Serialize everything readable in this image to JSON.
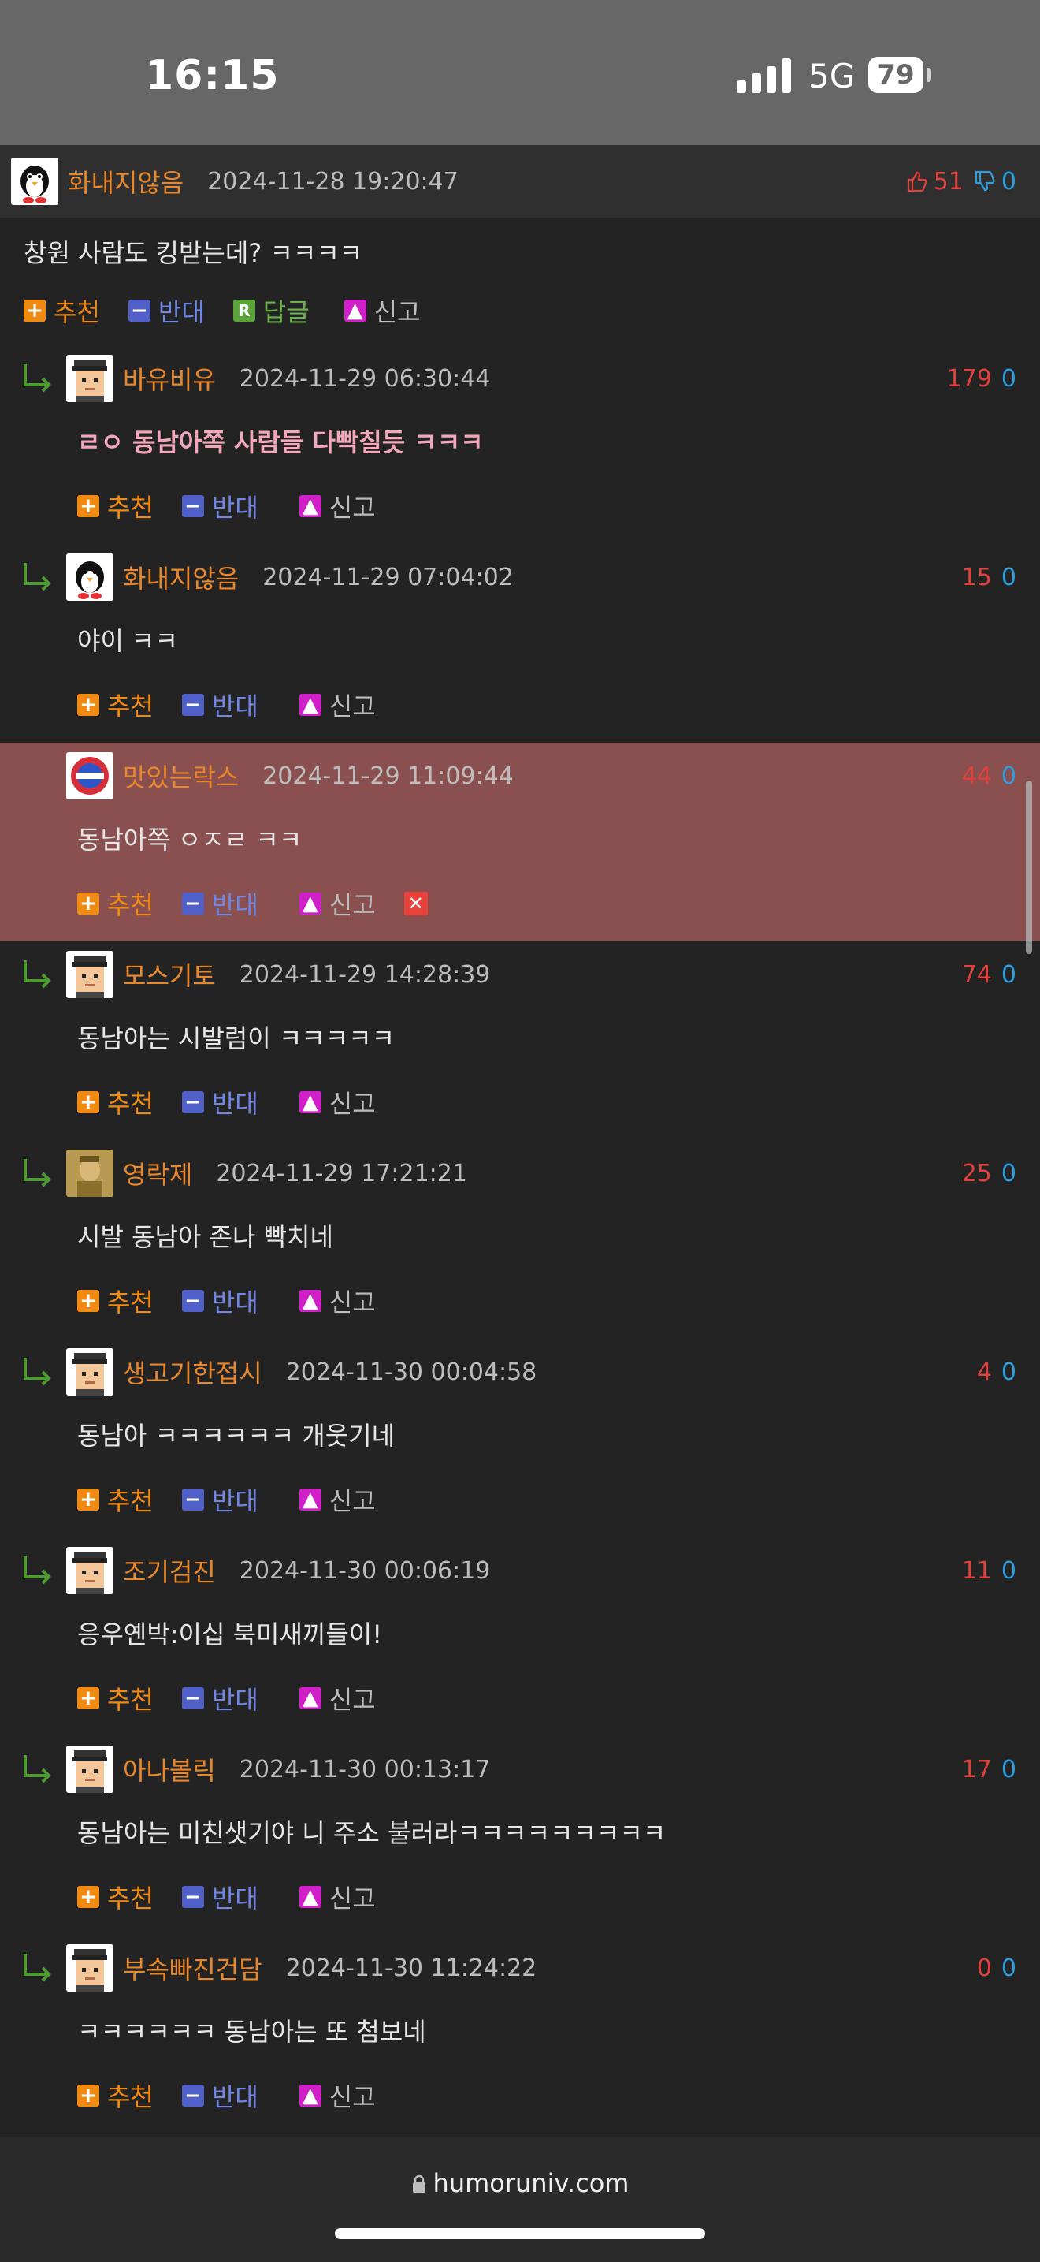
{
  "status_bar": {
    "time": "16:15",
    "network": "5G",
    "battery": "79"
  },
  "post": {
    "nickname": "화내지않음",
    "date": "2024-11-28 19:20:47",
    "upvotes": "51",
    "downvotes": "0",
    "content": "창원 사람도 킹받는데? ㅋㅋㅋㅋ",
    "actions": {
      "recommend": "추천",
      "oppose": "반대",
      "reply": "답글",
      "report": "신고"
    }
  },
  "labels": {
    "recommend": "추천",
    "oppose": "반대",
    "report": "신고",
    "delete": "✕"
  },
  "comments": [
    {
      "nickname": "바유비유",
      "date": "2024-11-29 06:30:44",
      "up": "179",
      "down": "0",
      "content": "ㄹㅇ 동남아쪽 사람들 다빡칠듯 ㅋㅋㅋ"
    },
    {
      "nickname": "화내지않음",
      "date": "2024-11-29 07:04:02",
      "up": "15",
      "down": "0",
      "content": "야이 ㅋㅋ"
    },
    {
      "nickname": "맛있는락스",
      "date": "2024-11-29 11:09:44",
      "up": "44",
      "down": "0",
      "content": "동남아쪽 ㅇㅈㄹ ㅋㅋ"
    },
    {
      "nickname": "모스기토",
      "date": "2024-11-29 14:28:39",
      "up": "74",
      "down": "0",
      "content": "동남아는 시발럼이 ㅋㅋㅋㅋㅋ"
    },
    {
      "nickname": "영락제",
      "date": "2024-11-29 17:21:21",
      "up": "25",
      "down": "0",
      "content": "시발 동남아 존나 빡치네"
    },
    {
      "nickname": "생고기한접시",
      "date": "2024-11-30 00:04:58",
      "up": "4",
      "down": "0",
      "content": "동남아 ㅋㅋㅋㅋㅋㅋ 개웃기네"
    },
    {
      "nickname": "조기검진",
      "date": "2024-11-30 00:06:19",
      "up": "11",
      "down": "0",
      "content": "응우옌박:이십 북미새끼들이!"
    },
    {
      "nickname": "아나볼릭",
      "date": "2024-11-30 00:13:17",
      "up": "17",
      "down": "0",
      "content": "동남아는 미친샛기야 니 주소 불러라ㅋㅋㅋㅋㅋㅋㅋㅋㅋ"
    },
    {
      "nickname": "부속빠진건담",
      "date": "2024-11-30 11:24:22",
      "up": "0",
      "down": "0",
      "content": "ㅋㅋㅋㅋㅋㅋ 동남아는 또 첨보네"
    }
  ],
  "bottom_bar": {
    "url": "humoruniv.com"
  },
  "colors": {
    "nickname": "#e8872b",
    "upvote": "#e0413d",
    "downvote": "#2d9ee0",
    "highlight": "#8a5050"
  }
}
